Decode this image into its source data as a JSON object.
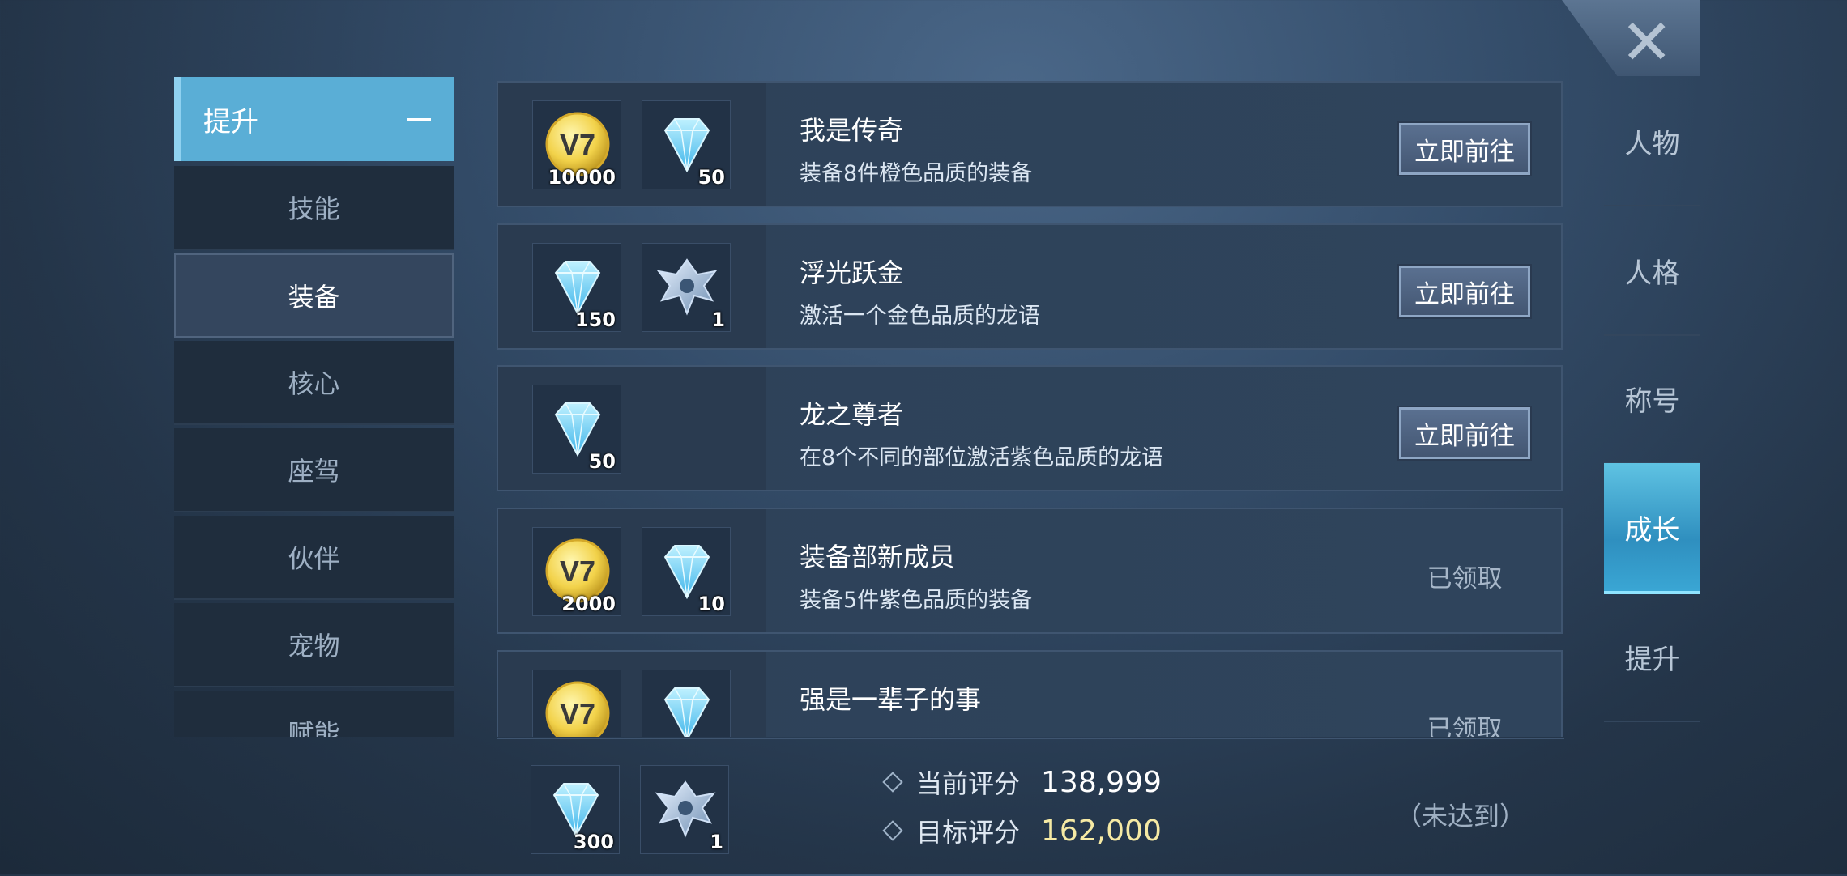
{
  "menu": {
    "header": "提升",
    "items": [
      "技能",
      "装备",
      "核心",
      "座驾",
      "伙伴",
      "宠物",
      "赋能"
    ],
    "selected": "装备"
  },
  "tasks": [
    {
      "title": "我是传奇",
      "desc": "装备8件橙色品质的装备",
      "rewards": [
        {
          "icon": "gold-coin-icon",
          "qty": "10000"
        },
        {
          "icon": "diamond-icon",
          "qty": "50"
        }
      ],
      "action": "立即前往",
      "status": "go"
    },
    {
      "title": "浮光跃金",
      "desc": "激活一个金色品质的龙语",
      "rewards": [
        {
          "icon": "diamond-icon",
          "qty": "150"
        },
        {
          "icon": "dragon-emblem-icon",
          "qty": "1"
        }
      ],
      "action": "立即前往",
      "status": "go"
    },
    {
      "title": "龙之尊者",
      "desc": "在8个不同的部位激活紫色品质的龙语",
      "rewards": [
        {
          "icon": "diamond-icon",
          "qty": "50"
        }
      ],
      "action": "立即前往",
      "status": "go"
    },
    {
      "title": "装备部新成员",
      "desc": "装备5件紫色品质的装备",
      "rewards": [
        {
          "icon": "gold-coin-icon",
          "qty": "2000"
        },
        {
          "icon": "diamond-icon",
          "qty": "10"
        }
      ],
      "action": "已领取",
      "status": "claimed"
    },
    {
      "title": "强是一辈子的事",
      "desc": "",
      "rewards": [
        {
          "icon": "gold-coin-icon",
          "qty": ""
        },
        {
          "icon": "diamond-icon",
          "qty": ""
        }
      ],
      "action": "已领取",
      "status": "claimed"
    }
  ],
  "bottom": {
    "rewards": [
      {
        "icon": "diamond-icon",
        "qty": "300"
      },
      {
        "icon": "dragon-emblem-icon",
        "qty": "1"
      }
    ],
    "current_label": "当前评分",
    "current_value": "138,999",
    "target_label": "目标评分",
    "target_value": "162,000",
    "status": "（未达到）"
  },
  "right_tabs": [
    "人物",
    "人格",
    "称号",
    "成长",
    "提升"
  ],
  "active_tab": "成长",
  "colors": {
    "accent": "#5aaed6",
    "target_score": "#f6eaa4",
    "active_tab": "#3aa6d4"
  }
}
